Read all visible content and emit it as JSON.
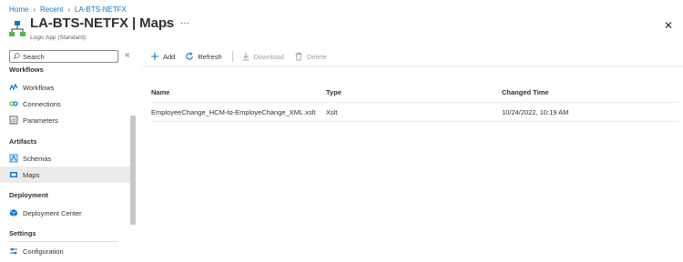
{
  "breadcrumb": [
    "Home",
    "Recent",
    "LA-BTS-NETFX"
  ],
  "header": {
    "title": "LA-BTS-NETFX | Maps",
    "subtitle": "Logic App (Standard)",
    "star_icon": "star-icon",
    "more_label": "···",
    "close_label": "✕"
  },
  "search": {
    "placeholder": "Search"
  },
  "collapse_label": "«",
  "sidebar": {
    "sections": [
      {
        "label": "Workflows"
      },
      {
        "label": "Artifacts"
      },
      {
        "label": "Deployment"
      },
      {
        "label": "Settings"
      }
    ],
    "items": [
      {
        "label": "Workflows",
        "icon": "workflows-icon"
      },
      {
        "label": "Connections",
        "icon": "connections-icon"
      },
      {
        "label": "Parameters",
        "icon": "parameters-icon"
      },
      {
        "label": "Schemas",
        "icon": "schemas-icon"
      },
      {
        "label": "Maps",
        "icon": "maps-icon",
        "active": true
      },
      {
        "label": "Deployment Center",
        "icon": "deployment-center-icon"
      },
      {
        "label": "Configuration",
        "icon": "configuration-icon"
      }
    ]
  },
  "toolbar": {
    "add": "Add",
    "refresh": "Refresh",
    "download": "Download",
    "delete": "Delete"
  },
  "table": {
    "columns": [
      "Name",
      "Type",
      "Changed Time"
    ],
    "rows": [
      [
        "EmployeeChange_HCM-to-EmployeChange_XML.xslt",
        "Xslt",
        "10/24/2022, 10:19 AM"
      ]
    ]
  },
  "colors": {
    "accent": "#0078d4",
    "active_bg": "#edebe9",
    "disabled_text": "#a19f9d"
  }
}
